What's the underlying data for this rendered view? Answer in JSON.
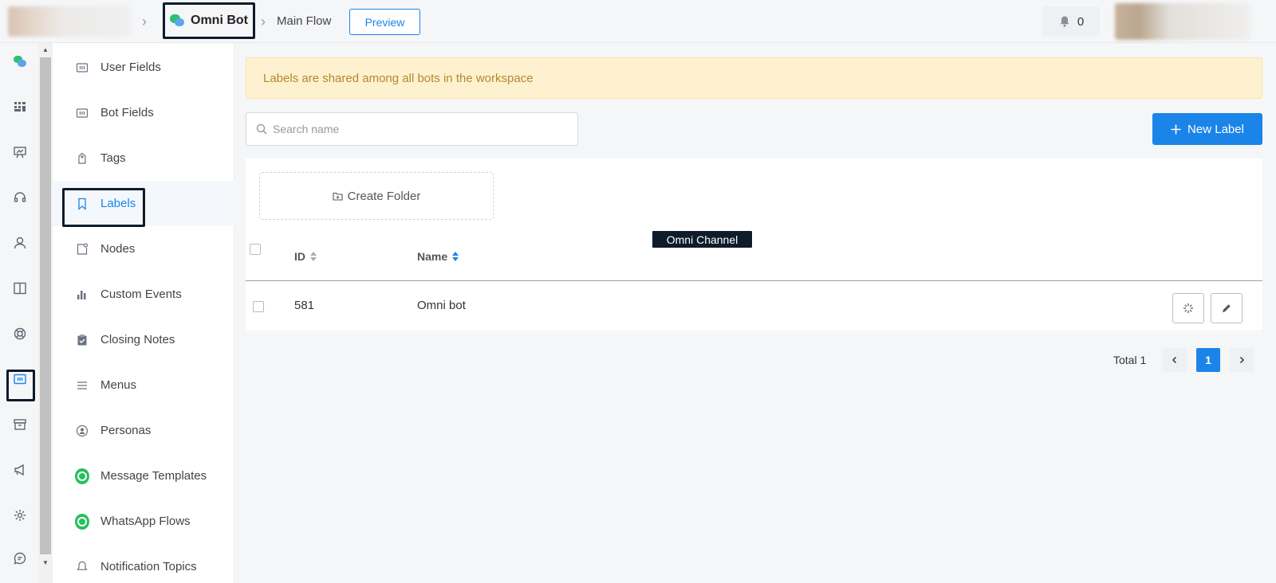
{
  "header": {
    "bot_name": "Omni Bot",
    "flow_name": "Main Flow",
    "preview_label": "Preview",
    "notification_count": "0"
  },
  "sidebar": {
    "items": [
      {
        "label": "User Fields",
        "icon": "field-icon"
      },
      {
        "label": "Bot Fields",
        "icon": "field-icon"
      },
      {
        "label": "Tags",
        "icon": "tag-icon"
      },
      {
        "label": "Labels",
        "icon": "bookmark-icon"
      },
      {
        "label": "Nodes",
        "icon": "node-icon"
      },
      {
        "label": "Custom Events",
        "icon": "bar-chart-icon"
      },
      {
        "label": "Closing Notes",
        "icon": "clipboard-icon"
      },
      {
        "label": "Menus",
        "icon": "menu-icon"
      },
      {
        "label": "Personas",
        "icon": "persona-icon"
      },
      {
        "label": "Message Templates",
        "icon": "whatsapp-icon"
      },
      {
        "label": "WhatsApp Flows",
        "icon": "whatsapp-icon"
      },
      {
        "label": "Notification Topics",
        "icon": "bell-icon"
      }
    ]
  },
  "main": {
    "notice": "Labels are shared among all bots in the workspace",
    "search_placeholder": "Search name",
    "new_label": "New Label",
    "create_folder": "Create Folder",
    "columns": {
      "id": "ID",
      "name": "Name"
    },
    "rows": [
      {
        "id": "581",
        "name": "Omni bot"
      }
    ],
    "tooltip": "Omni Channel",
    "pagination": {
      "total_label": "Total 1",
      "current_page": "1"
    }
  },
  "colors": {
    "accent": "#1a84e8",
    "notice_bg": "#fdf1cf",
    "notice_text": "#b3892e",
    "highlight_box": "#0e1b2b"
  }
}
